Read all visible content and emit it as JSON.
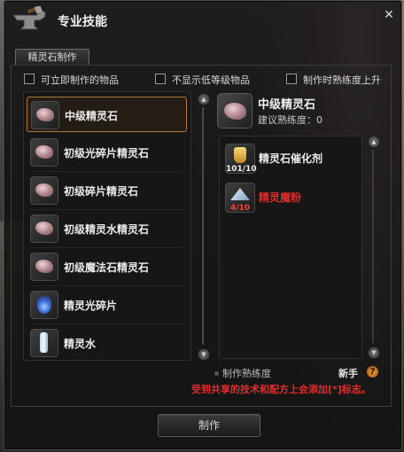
{
  "window": {
    "title": "专业技能",
    "close_glyph": "✕"
  },
  "tabs": [
    {
      "label": "精灵石制作",
      "selected": true
    }
  ],
  "filters": [
    {
      "label": "可立即制作的物品",
      "checked": false
    },
    {
      "label": "不显示低等级物品",
      "checked": false
    },
    {
      "label": "制作时熟练度上升",
      "checked": false
    }
  ],
  "recipes": [
    {
      "label": "中级精灵石",
      "icon": "spirit-stone-icon",
      "selected": true
    },
    {
      "label": "初级光碎片精灵石",
      "icon": "spirit-stone-icon",
      "selected": false
    },
    {
      "label": "初级碎片精灵石",
      "icon": "spirit-stone-icon",
      "selected": false
    },
    {
      "label": "初级精灵水精灵石",
      "icon": "spirit-stone-icon",
      "selected": false
    },
    {
      "label": "初级魔法石精灵石",
      "icon": "spirit-stone-icon",
      "selected": false
    },
    {
      "label": "精灵光碎片",
      "icon": "light-fragment-icon",
      "selected": false
    },
    {
      "label": "精灵水",
      "icon": "spirit-water-icon",
      "selected": false
    }
  ],
  "detail": {
    "name": "中级精灵石",
    "proficiency_label": "建议熟练度：",
    "proficiency_value": "0",
    "materials": [
      {
        "name": "精灵石催化剂",
        "count": "101/10",
        "enough": true,
        "icon": "catalyst-icon"
      },
      {
        "name": "精灵魔粉",
        "count": "4/10",
        "enough": false,
        "icon": "magic-powder-icon"
      }
    ]
  },
  "skill": {
    "label": "制作熟练度",
    "rank": "新手",
    "help_glyph": "?"
  },
  "notice": "受到共享的技术和配方上会添加[*]标志。",
  "actions": {
    "make_label": "制作"
  },
  "colors": {
    "accent_border": "#b07a3c",
    "insufficient": "#e02c2c",
    "warning_text": "#e02c2c"
  }
}
